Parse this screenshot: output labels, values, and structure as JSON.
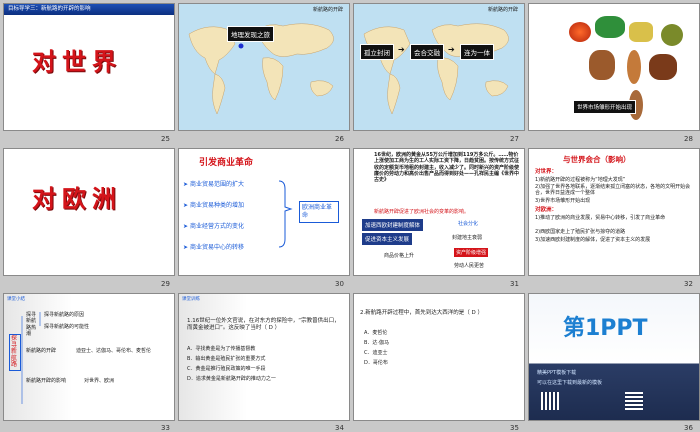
{
  "slides": [
    {
      "num": "25",
      "banner": "目标导学三：新航路的开辟的影响",
      "big": "对世界"
    },
    {
      "num": "26",
      "map_title": "新航路的开辟",
      "label": "地理发现之旅"
    },
    {
      "num": "27",
      "map_title": "新航路的开辟",
      "boxes": [
        "孤立封闭",
        "会合交融",
        "连为一体"
      ]
    },
    {
      "num": "28",
      "caption": "世界市场雏形开始出现"
    },
    {
      "num": "29",
      "big": "对欧洲"
    },
    {
      "num": "30",
      "title": "引发商业革命",
      "items": [
        "商业贸易范围的扩大",
        "商业贸易种类的增加",
        "商业经营方式的变化",
        "商业贸易中心的转移"
      ],
      "result": "欧洲商业革命"
    },
    {
      "num": "31",
      "text": "16世纪，欧洲的黄金从55万公斤增加到119万多公斤。……物价上涨使加工商为生的工人实际工资下降，日趋贫困。按传统方式征收的定额货币地租的封建主，收入减少了。同时新兴的资产阶级使廉价的劳动力和高价出售产品而得到好处——孔祥民主编《世界中古史》",
      "note": "新航路开辟促进了欧洲社会的变革的影响。",
      "boxes": [
        "加速西欧封建制度解体",
        "促进资本主义发展"
      ],
      "side": [
        "社会分化",
        "封建地主衰弱",
        "资产阶级增强"
      ],
      "bottom": [
        "商品价格上升",
        "劳动人民更苦"
      ]
    },
    {
      "num": "32",
      "title": "与世界会合（影响）",
      "h1": "对世界：",
      "l1": [
        "1)新航路开辟的过程被称为“地理大发现”",
        "2)加强了世界各地联系，逐渐结束孤立闭塞的状态，各地的文明开始会合，世界日益连成一个整体",
        "3)世界市场雏形开始出现"
      ],
      "h2": "对欧洲：",
      "l2": [
        "1)推动了欧洲的商业发展，贸易中心转移，引发了商业革命",
        "2)西欧国家走上了殖民扩张与掠夺的道路",
        "3)加速西欧封建制度的解体，促进了资本主义的发展"
      ]
    },
    {
      "num": "33",
      "corner": "课堂小结",
      "root": "探寻新航路",
      "groups": [
        "探寻新航路热潮",
        "新航路的开辟",
        "新航路开辟的影响"
      ],
      "lines": [
        "探寻新航路的原因",
        "探寻新航路的可能性",
        "迪亚士、达伽马、哥伦布、麦哲伦",
        "对世界、欧洲"
      ]
    },
    {
      "num": "34",
      "corner": "课堂训练",
      "q": "1.16世纪一位外文官说，在对东方的探险中，“宗教曾供出口，而黄金被进口”。这反映了当时（ D ）",
      "opts": [
        "A．寻找黄金是为了传播基督教",
        "B．输出黄金是殖民扩张的重要方式",
        "C．黄金是推行殖民政策的唯一手段",
        "D．追求黄金是新航路开辟的推动力之一"
      ]
    },
    {
      "num": "35",
      "q": "2.新航路开辟过程中，首先到达大西洋的是（ D ）",
      "answer": "D",
      "opts": [
        "A．麦哲伦",
        "B．达·伽马",
        "C．迪亚士",
        "D．哥伦布"
      ]
    },
    {
      "num": "36",
      "brand": "第1PPT",
      "lines": [
        "精美PPT模板下载",
        "可以在这里下载到最新的模板"
      ]
    }
  ]
}
